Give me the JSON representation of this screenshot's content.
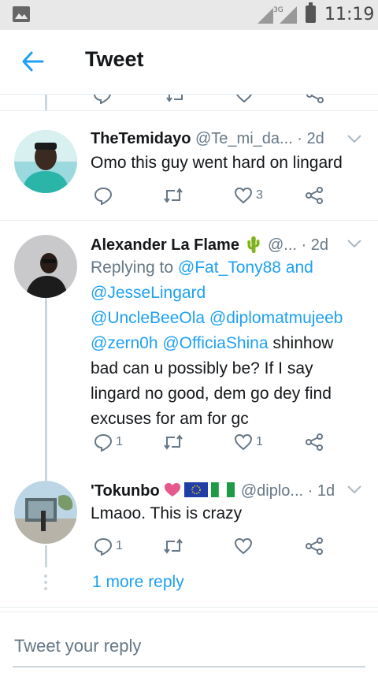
{
  "status_bar": {
    "time": "11:19",
    "network": "3G"
  },
  "header": {
    "title": "Tweet"
  },
  "tweets": [
    {
      "name": "TheTemidayo",
      "handle": "@Te_mi_da...",
      "time": "· 2d",
      "text": "Omo this guy went hard on lingard",
      "reply_count": "",
      "retweet_count": "",
      "like_count": "3"
    },
    {
      "name": "Alexander La Flame 🌵",
      "handle": "@...",
      "time": "· 2d",
      "replying_prefix": "Replying to ",
      "replying_to": "@Fat_Tony88 and @JesseLingard",
      "mentions": "@UncleBeeOla @diplomatmujeeb @zern0h @OfficiaShina",
      "text": " shinhow bad can u possibly be? If I say lingard no good, dem go dey find excuses for am for gc",
      "reply_count": "1",
      "retweet_count": "",
      "like_count": "1"
    },
    {
      "name": "'Tokunbo",
      "handle": "@diplo...",
      "time": "· 1d",
      "text": "Lmaoo. This is crazy",
      "reply_count": "1",
      "retweet_count": "",
      "like_count": ""
    }
  ],
  "more_reply": "1 more reply",
  "reply_box": {
    "placeholder": "Tweet your reply"
  },
  "colors": {
    "accent": "#1da1f2",
    "secondary_text": "#657786",
    "divider": "#e6ecf0"
  }
}
